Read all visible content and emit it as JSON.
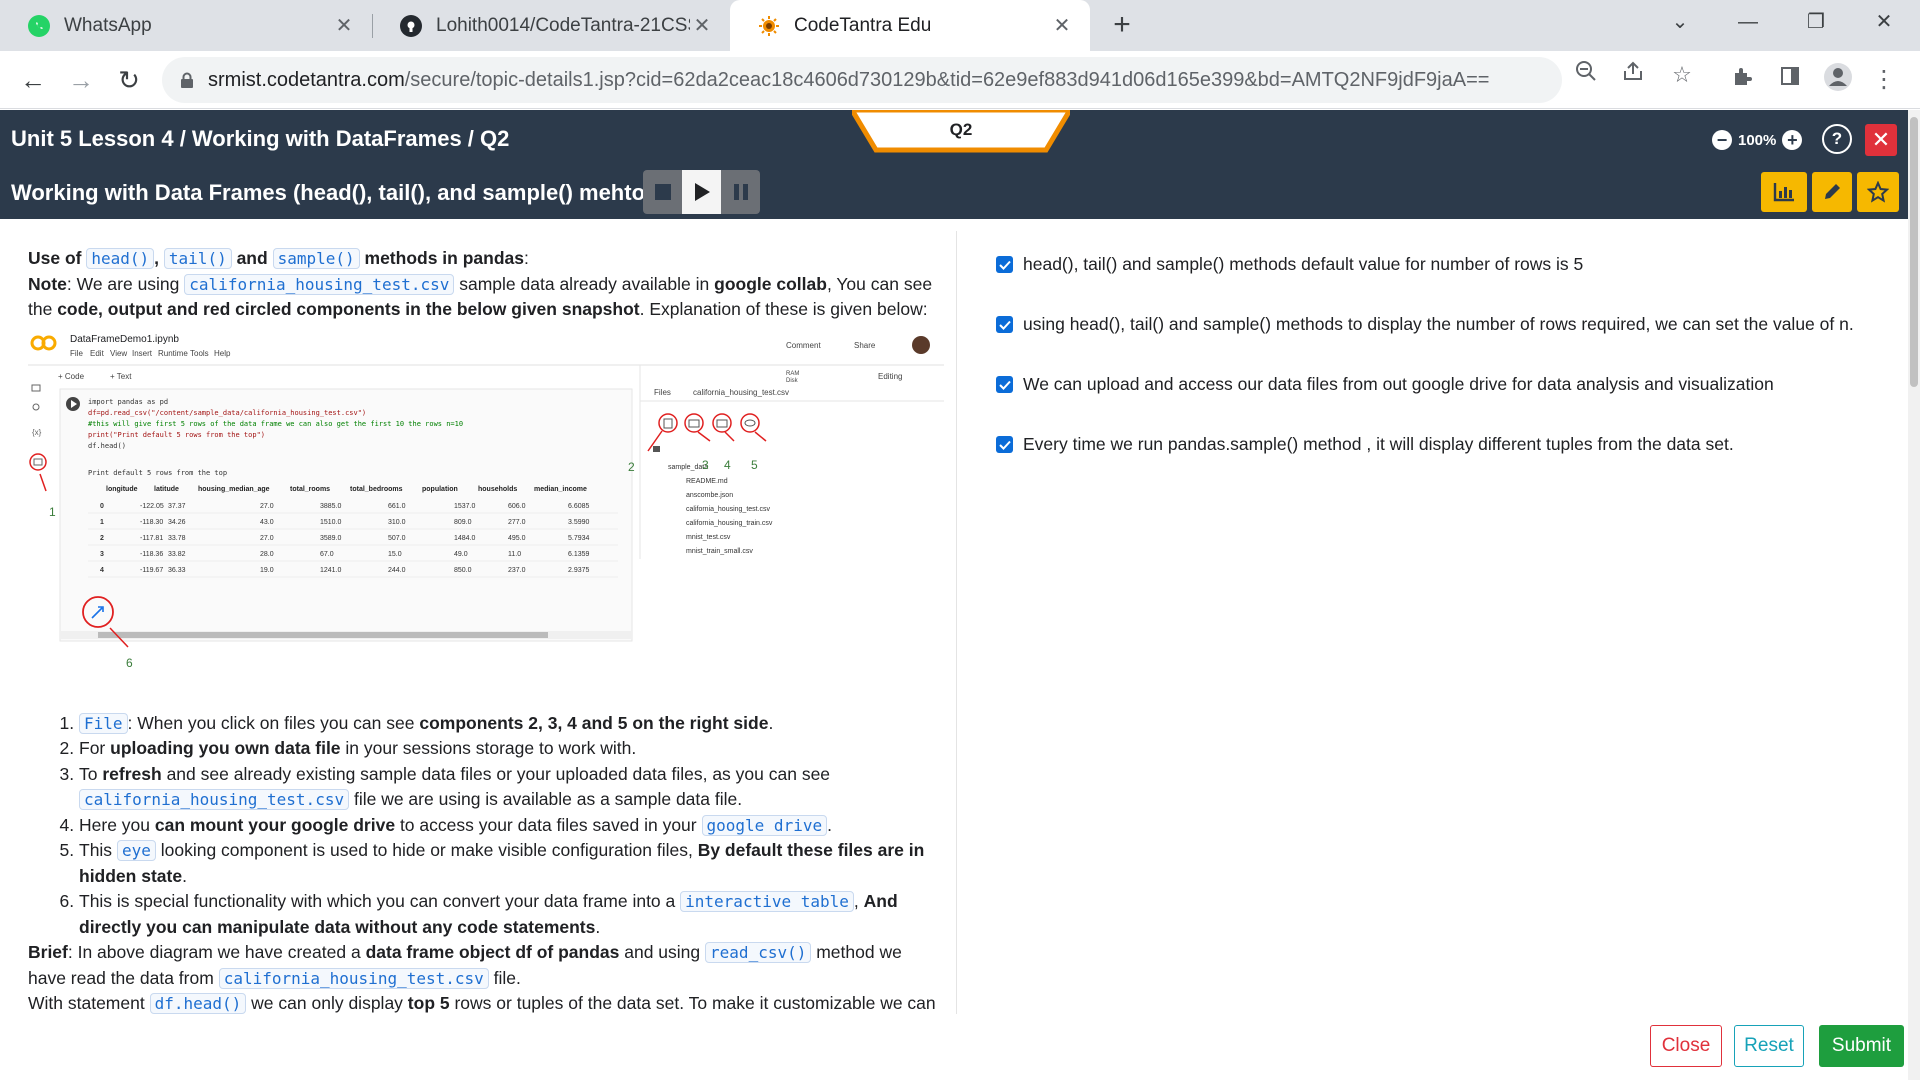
{
  "browser": {
    "tabs": [
      {
        "title": "WhatsApp",
        "close": "✕"
      },
      {
        "title": "Lohith0014/CodeTantra-21CSS10",
        "close": "✕"
      },
      {
        "title": "CodeTantra Edu",
        "close": "✕"
      }
    ],
    "new_tab": "+",
    "url_host": "srmist.codetantra.com",
    "url_path": "/secure/topic-details1.jsp?cid=62da2ceac18c4606d730129b&tid=62e9ef883d941d06d165e399&bd=AMTQ2NF9jdF9jaA=="
  },
  "app": {
    "breadcrumb": "Unit 5 Lesson 4 / Working with DataFrames / Q2",
    "lesson_title": "Working with Data Frames (head(), tail(), and sample() mehtods",
    "question_tab": "Q2",
    "zoom": "100%",
    "help": "?",
    "close": "✕"
  },
  "content": {
    "intro": {
      "use_of": "Use of",
      "head": "head()",
      "tail": "tail()",
      "and": "and",
      "sample": "sample()",
      "methods_in_pandas": "methods in pandas",
      "colon": ":",
      "note_label": "Note",
      "note_t1": ": We are using",
      "csv": "california_housing_test.csv",
      "note_t2": "sample data already available in",
      "google_collab": "google collab",
      "note_t3": ", You can see the",
      "components": "code, output and red circled components in the below given snapshot",
      "note_t4": ". Explanation of these is given below:"
    },
    "snapshot": {
      "notebook_name": "DataFrameDemo1.ipynb",
      "menu": [
        "File",
        "Edit",
        "View",
        "Insert",
        "Runtime",
        "Tools",
        "Help"
      ],
      "comment": "Comment",
      "share": "Share",
      "code_btn": "+ Code",
      "text_btn": "+ Text",
      "ram": "RAM",
      "disk": "Disk",
      "editing": "Editing",
      "code_lines": [
        "import pandas as pd",
        "df=pd.read_csv(\"/content/sample_data/california_housing_test.csv\")",
        "#this will give first 5 rows of the data frame we can also get the first 10 the rows n=10",
        "print(\"Print default 5 rows from the top\")",
        "df.head()"
      ],
      "output_line": "Print default 5 rows from the top",
      "table_headers": [
        "longitude",
        "latitude",
        "housing_median_age",
        "total_rooms",
        "total_bedrooms",
        "population",
        "households",
        "median_income"
      ],
      "table_rows": [
        [
          "0",
          "-122.05",
          "37.37",
          "27.0",
          "3885.0",
          "661.0",
          "1537.0",
          "606.0",
          "6.6085"
        ],
        [
          "1",
          "-118.30",
          "34.26",
          "43.0",
          "1510.0",
          "310.0",
          "809.0",
          "277.0",
          "3.5990"
        ],
        [
          "2",
          "-117.81",
          "33.78",
          "27.0",
          "3589.0",
          "507.0",
          "1484.0",
          "495.0",
          "5.7934"
        ],
        [
          "3",
          "-118.36",
          "33.82",
          "28.0",
          "67.0",
          "15.0",
          "49.0",
          "11.0",
          "6.1359"
        ],
        [
          "4",
          "-119.67",
          "36.33",
          "19.0",
          "1241.0",
          "244.0",
          "850.0",
          "237.0",
          "2.9375"
        ]
      ],
      "files_tab": "Files",
      "files_tab2": "california_housing_test.csv",
      "folder": "sample_data",
      "files": [
        "README.md",
        "anscombe.json",
        "california_housing_test.csv",
        "california_housing_train.csv",
        "mnist_test.csv",
        "mnist_train_small.csv"
      ],
      "markers": [
        "1",
        "2",
        "3",
        "4",
        "5",
        "6"
      ]
    },
    "list": [
      {
        "code": "File",
        "t1": ": When you click on files you can see",
        "b1": "components 2, 3, 4 and 5 on the right side",
        "t2": "."
      },
      {
        "t1": "For",
        "b1": "uploading you own data file",
        "t2": "in your sessions storage to work with."
      },
      {
        "t1": "To",
        "b1": "refresh",
        "t2": "and see already existing sample data files or your uploaded data files, as you can see",
        "code": "california_housing_test.csv",
        "t3": "file we are using is available as a sample data file."
      },
      {
        "t1": "Here you",
        "b1": "can mount your google drive",
        "t2": "to access your data files saved in your",
        "code": "google drive",
        "t3": "."
      },
      {
        "t1": "This",
        "code": "eye",
        "t2": "looking component is used to hide or make visible configuration files,",
        "b1": "By default these files are in hidden state",
        "t3": "."
      },
      {
        "t1": "This is special functionality with which you can convert your data frame into a",
        "code": "interactive table",
        "t2": ",",
        "b1": "And directly you can manipulate data without any code statements",
        "t3": "."
      }
    ],
    "brief": {
      "label": "Brief",
      "t1": ": In above diagram we have created a",
      "b1": "data frame object df of pandas",
      "t2": "and using",
      "code1": "read_csv()",
      "t3": "method we have read the data from",
      "code2": "california_housing_test.csv",
      "t4": "file.",
      "t5": "With statement",
      "code3": "df.head()",
      "t6": "we can only display",
      "b2": "top 5",
      "t7": "rows or tuples of the data set. To make it customizable we can"
    },
    "options": [
      {
        "checked": true,
        "label": "head(), tail() and sample() methods default value for number of rows is 5"
      },
      {
        "checked": true,
        "label": "using head(), tail() and sample() methods to display the number of rows required, we can set the value of n."
      },
      {
        "checked": true,
        "label": "We can upload and access our data files from out google drive for data analysis and visualization"
      },
      {
        "checked": true,
        "label": "Every time we run pandas.sample() method , it will display different tuples from the data set."
      }
    ]
  },
  "footer": {
    "close": "Close",
    "reset": "Reset",
    "submit": "Submit"
  },
  "colors": {
    "header": "#2c3a4b",
    "accent_orange": "#f08c00",
    "yellow": "#f6b800",
    "close_red": "#e0313b",
    "submit_green": "#1e9e3e",
    "reset_teal": "#17a2b8",
    "code_blue": "#1f6fd1"
  }
}
